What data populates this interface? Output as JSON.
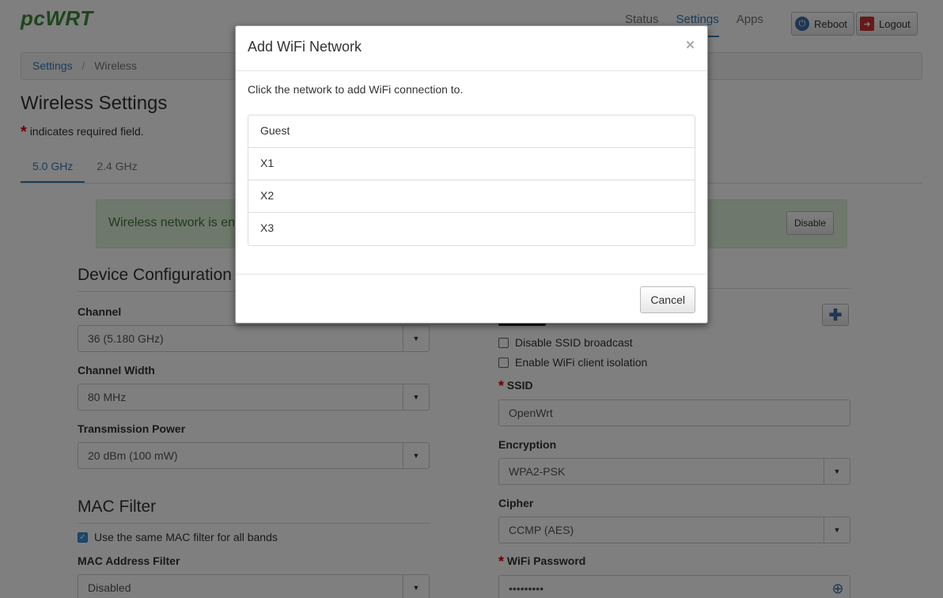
{
  "app": {
    "logo": "pcWRT"
  },
  "nav": {
    "items": [
      "Status",
      "Settings",
      "Apps"
    ],
    "reboot": "Reboot",
    "logout": "Logout"
  },
  "breadcrumb": {
    "root": "Settings",
    "sep": "/",
    "current": "Wireless"
  },
  "page": {
    "title": "Wireless Settings",
    "required_note": "indicates required field.",
    "required_star": "*"
  },
  "tabs": [
    "5.0 GHz",
    "2.4 GHz"
  ],
  "alert": {
    "text": "Wireless network is en",
    "button": "Disable"
  },
  "device": {
    "title": "Device Configuration",
    "channel_label": "Channel",
    "channel_value": "36 (5.180 GHz)",
    "width_label": "Channel Width",
    "width_value": "80 MHz",
    "power_label": "Transmission Power",
    "power_value": "20 dBm (100 mW)"
  },
  "mac": {
    "title": "MAC Filter",
    "same_filter_label": "Use the same MAC filter for all bands",
    "filter_label": "MAC Address Filter",
    "filter_value": "Disabled"
  },
  "network": {
    "disable_ssid_label": "Disable SSID broadcast",
    "isolation_label": "Enable WiFi client isolation",
    "ssid_label": "SSID",
    "ssid_value": "OpenWrt",
    "encryption_label": "Encryption",
    "encryption_value": "WPA2-PSK",
    "cipher_label": "Cipher",
    "cipher_value": "CCMP (AES)",
    "password_label": "WiFi Password",
    "password_value": "•••••••••"
  },
  "modal": {
    "title": "Add WiFi Network",
    "close": "×",
    "message": "Click the network to add WiFi connection to.",
    "networks": [
      "Guest",
      "X1",
      "X2",
      "X3"
    ],
    "cancel": "Cancel"
  }
}
